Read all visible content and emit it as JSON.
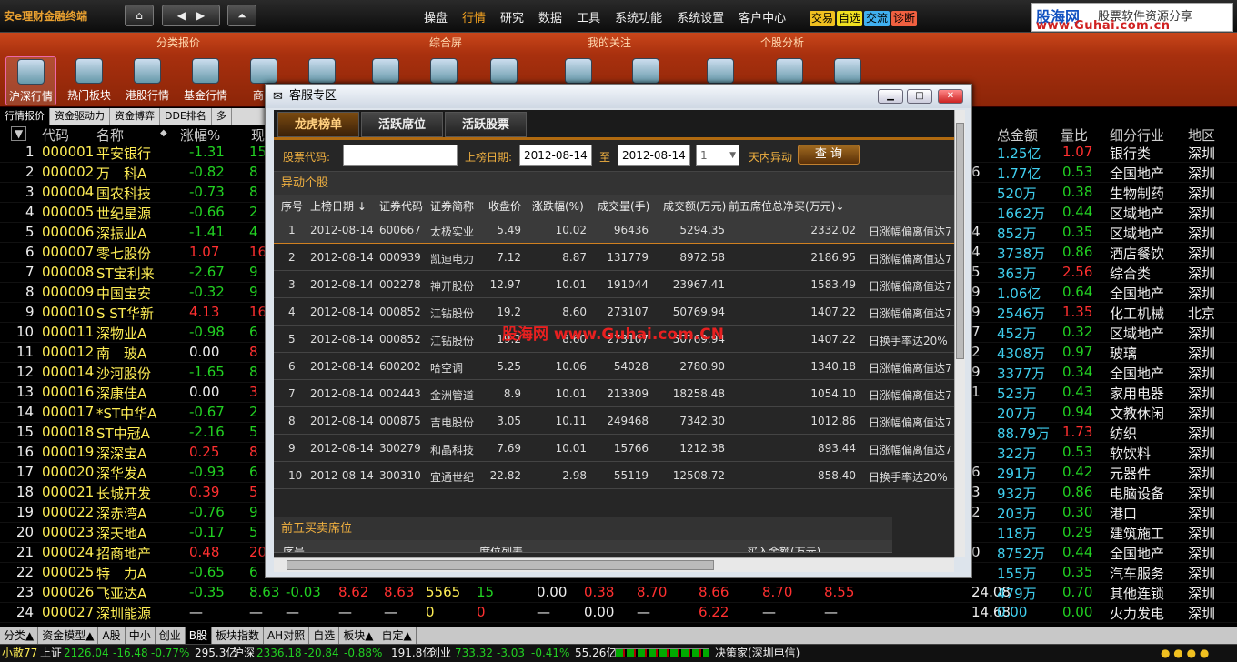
{
  "brand": "安e理财金融终端",
  "menu": [
    "操盘",
    "行情",
    "研究",
    "数据",
    "工具",
    "系统功能",
    "系统设置",
    "客户中心"
  ],
  "tags": [
    {
      "t": "交易",
      "bg": "#f0c020"
    },
    {
      "t": "自选",
      "bg": "#f0e020"
    },
    {
      "t": "交流",
      "bg": "#40b0f0"
    },
    {
      "t": "诊断",
      "bg": "#f06040"
    }
  ],
  "logo": {
    "a": "股海网",
    "b": "股票软件资源分享",
    "c": "www.Guhai.com.cn"
  },
  "ribbon_groups": [
    "分类报价",
    "综合屏",
    "我的关注",
    "个股分析"
  ],
  "ribbon_btns": [
    "沪深行情",
    "热门板块",
    "港股行情",
    "基金行情",
    "商品"
  ],
  "subtabs": [
    "行情报价",
    "资金驱动力",
    "资金博弈",
    "DDE排名",
    "多"
  ],
  "hdr": {
    "code": "代码",
    "name": "名称",
    "chg": "涨幅%",
    "now": "现",
    "amt": "总金额",
    "vr": "量比",
    "ind": "细分行业",
    "reg": "地区"
  },
  "rows": [
    [
      "1",
      "000001",
      "平安银行",
      "-1.31",
      "15",
      "",
      "1.25亿",
      "1.07",
      "银行类",
      "深圳"
    ],
    [
      "2",
      "000002",
      "万　科A",
      "-0.82",
      "8",
      "6",
      "1.77亿",
      "0.53",
      "全国地产",
      "深圳"
    ],
    [
      "3",
      "000004",
      "国农科技",
      "-0.73",
      "8",
      "",
      "520万",
      "0.38",
      "生物制药",
      "深圳"
    ],
    [
      "4",
      "000005",
      "世纪星源",
      "-0.66",
      "2",
      "",
      "1662万",
      "0.44",
      "区域地产",
      "深圳"
    ],
    [
      "5",
      "000006",
      "深振业A",
      "-1.41",
      "4",
      "4",
      "852万",
      "0.35",
      "区域地产",
      "深圳"
    ],
    [
      "6",
      "000007",
      "零七股份",
      "1.07",
      "16",
      "4",
      "3738万",
      "0.86",
      "酒店餐饮",
      "深圳"
    ],
    [
      "7",
      "000008",
      "ST宝利来",
      "-2.67",
      "9",
      "5",
      "363万",
      "2.56",
      "综合类",
      "深圳"
    ],
    [
      "8",
      "000009",
      "中国宝安",
      "-0.32",
      "9",
      "9",
      "1.06亿",
      "0.64",
      "全国地产",
      "深圳"
    ],
    [
      "9",
      "000010",
      "S ST华新",
      "4.13",
      "16",
      "9",
      "2546万",
      "1.35",
      "化工机械",
      "北京"
    ],
    [
      "10",
      "000011",
      "深物业A",
      "-0.98",
      "6",
      "7",
      "452万",
      "0.32",
      "区域地产",
      "深圳"
    ],
    [
      "11",
      "000012",
      "南　玻A",
      "0.00",
      "8",
      "2",
      "4308万",
      "0.97",
      "玻璃",
      "深圳"
    ],
    [
      "12",
      "000014",
      "沙河股份",
      "-1.65",
      "8",
      "9",
      "3377万",
      "0.34",
      "全国地产",
      "深圳"
    ],
    [
      "13",
      "000016",
      "深康佳A",
      "0.00",
      "3",
      "1",
      "523万",
      "0.43",
      "家用电器",
      "深圳"
    ],
    [
      "14",
      "000017",
      "*ST中华A",
      "-0.67",
      "2",
      "",
      "207万",
      "0.94",
      "文教休闲",
      "深圳"
    ],
    [
      "15",
      "000018",
      "ST中冠A",
      "-2.16",
      "5",
      "",
      "88.79万",
      "1.73",
      "纺织",
      "深圳"
    ],
    [
      "16",
      "000019",
      "深深宝A",
      "0.25",
      "8",
      "",
      "322万",
      "0.53",
      "软饮料",
      "深圳"
    ],
    [
      "17",
      "000020",
      "深华发A",
      "-0.93",
      "6",
      "6",
      "291万",
      "0.42",
      "元器件",
      "深圳"
    ],
    [
      "18",
      "000021",
      "长城开发",
      "0.39",
      "5",
      "3",
      "932万",
      "0.86",
      "电脑设备",
      "深圳"
    ],
    [
      "19",
      "000022",
      "深赤湾A",
      "-0.76",
      "9",
      "2",
      "203万",
      "0.30",
      "港口",
      "深圳"
    ],
    [
      "20",
      "000023",
      "深天地A",
      "-0.17",
      "5",
      "",
      "118万",
      "0.29",
      "建筑施工",
      "深圳"
    ],
    [
      "21",
      "000024",
      "招商地产",
      "0.48",
      "20",
      "0",
      "8752万",
      "0.44",
      "全国地产",
      "深圳"
    ],
    [
      "22",
      "000025",
      "特　力A",
      "-0.65",
      "6",
      "",
      "155万",
      "0.35",
      "汽车服务",
      "深圳"
    ],
    [
      "23",
      "000026",
      "飞亚达A",
      "-0.35",
      "8.63",
      "24.08",
      "479万",
      "0.70",
      "其他连锁",
      "深圳"
    ],
    [
      "24",
      "000027",
      "深圳能源",
      "—",
      "—",
      "14.68",
      "0.00",
      "0.00",
      "火力发电",
      "深圳"
    ]
  ],
  "row23": [
    "-0.03",
    "8.62",
    "8.63",
    "5565",
    "15",
    "0.00",
    "0.38",
    "8.70",
    "8.66",
    "8.70",
    "8.55"
  ],
  "row24": [
    "—",
    "—",
    "—",
    "0",
    "0",
    "—",
    "0.00",
    "—",
    "6.22",
    "—",
    "—"
  ],
  "bottomtabs": [
    "分类▲",
    "资金模型▲",
    "A股",
    "中小",
    "创业",
    "B股",
    "板块指数",
    "AH对照",
    "自选",
    "板块▲",
    "自定▲"
  ],
  "status": {
    "a": "小散77",
    "sh": "上证",
    "shv": "2126.04",
    "shc": "-16.48",
    "shp": "-0.77%",
    "sha": "295.3亿",
    "sz": "沪深",
    "szv": "2336.18",
    "szc": "-20.84",
    "szp": "-0.88%",
    "sza": "191.8亿",
    "cy": "创业",
    "cyv": "733.32",
    "cyc": "-3.03",
    "cyp": "-0.41%",
    "cya": "55.26亿",
    "src": "决策家(深圳电信)"
  },
  "dlg": {
    "title": "客服专区",
    "tabs": [
      "龙虎榜单",
      "活跃席位",
      "活跃股票"
    ],
    "lbl_code": "股票代码:",
    "lbl_date": "上榜日期:",
    "d1": "2012-08-14",
    "to": "至",
    "d2": "2012-08-14",
    "days": "1",
    "lbl_days": "天内异动",
    "query": "查 询",
    "sect1": "异动个股",
    "sect2": "前五买卖席位",
    "sect2_h1": "序号",
    "sect2_h2": "席位列表",
    "sect2_h3": "买入金额(万元)"
  },
  "dhdr": [
    "序号",
    "上榜日期 ↓",
    "证券代码",
    "证券简称",
    "收盘价",
    "涨跌幅(%)",
    "成交量(手)",
    "成交额(万元)",
    "前五席位总净买(万元)↓"
  ],
  "drows": [
    [
      "1",
      "2012-08-14",
      "600667",
      "太极实业",
      "5.49",
      "10.02",
      "96436",
      "5294.35",
      "2332.02",
      "日涨幅偏离值达7"
    ],
    [
      "2",
      "2012-08-14",
      "000939",
      "凯迪电力",
      "7.12",
      "8.87",
      "131779",
      "8972.58",
      "2186.95",
      "日涨幅偏离值达7"
    ],
    [
      "3",
      "2012-08-14",
      "002278",
      "神开股份",
      "12.97",
      "10.01",
      "191044",
      "23967.41",
      "1583.49",
      "日涨幅偏离值达7"
    ],
    [
      "4",
      "2012-08-14",
      "000852",
      "江钻股份",
      "19.2",
      "8.60",
      "273107",
      "50769.94",
      "1407.22",
      "日涨幅偏离值达7"
    ],
    [
      "5",
      "2012-08-14",
      "000852",
      "江钻股份",
      "19.2",
      "8.60",
      "273107",
      "50769.94",
      "1407.22",
      "日换手率达20%"
    ],
    [
      "6",
      "2012-08-14",
      "600202",
      "哈空调",
      "5.25",
      "10.06",
      "54028",
      "2780.90",
      "1340.18",
      "日涨幅偏离值达7"
    ],
    [
      "7",
      "2012-08-14",
      "002443",
      "金洲管道",
      "8.9",
      "10.01",
      "213309",
      "18258.48",
      "1054.10",
      "日涨幅偏离值达7"
    ],
    [
      "8",
      "2012-08-14",
      "000875",
      "吉电股份",
      "3.05",
      "10.11",
      "249468",
      "7342.30",
      "1012.86",
      "日涨幅偏离值达7"
    ],
    [
      "9",
      "2012-08-14",
      "300279",
      "和晶科技",
      "7.69",
      "10.01",
      "15766",
      "1212.38",
      "893.44",
      "日涨幅偏离值达7"
    ],
    [
      "10",
      "2012-08-14",
      "300310",
      "宜通世纪",
      "22.82",
      "-2.98",
      "55119",
      "12508.72",
      "858.40",
      "日换手率达20%"
    ]
  ],
  "watermark": "股海网 www.Guhai.com.CN"
}
